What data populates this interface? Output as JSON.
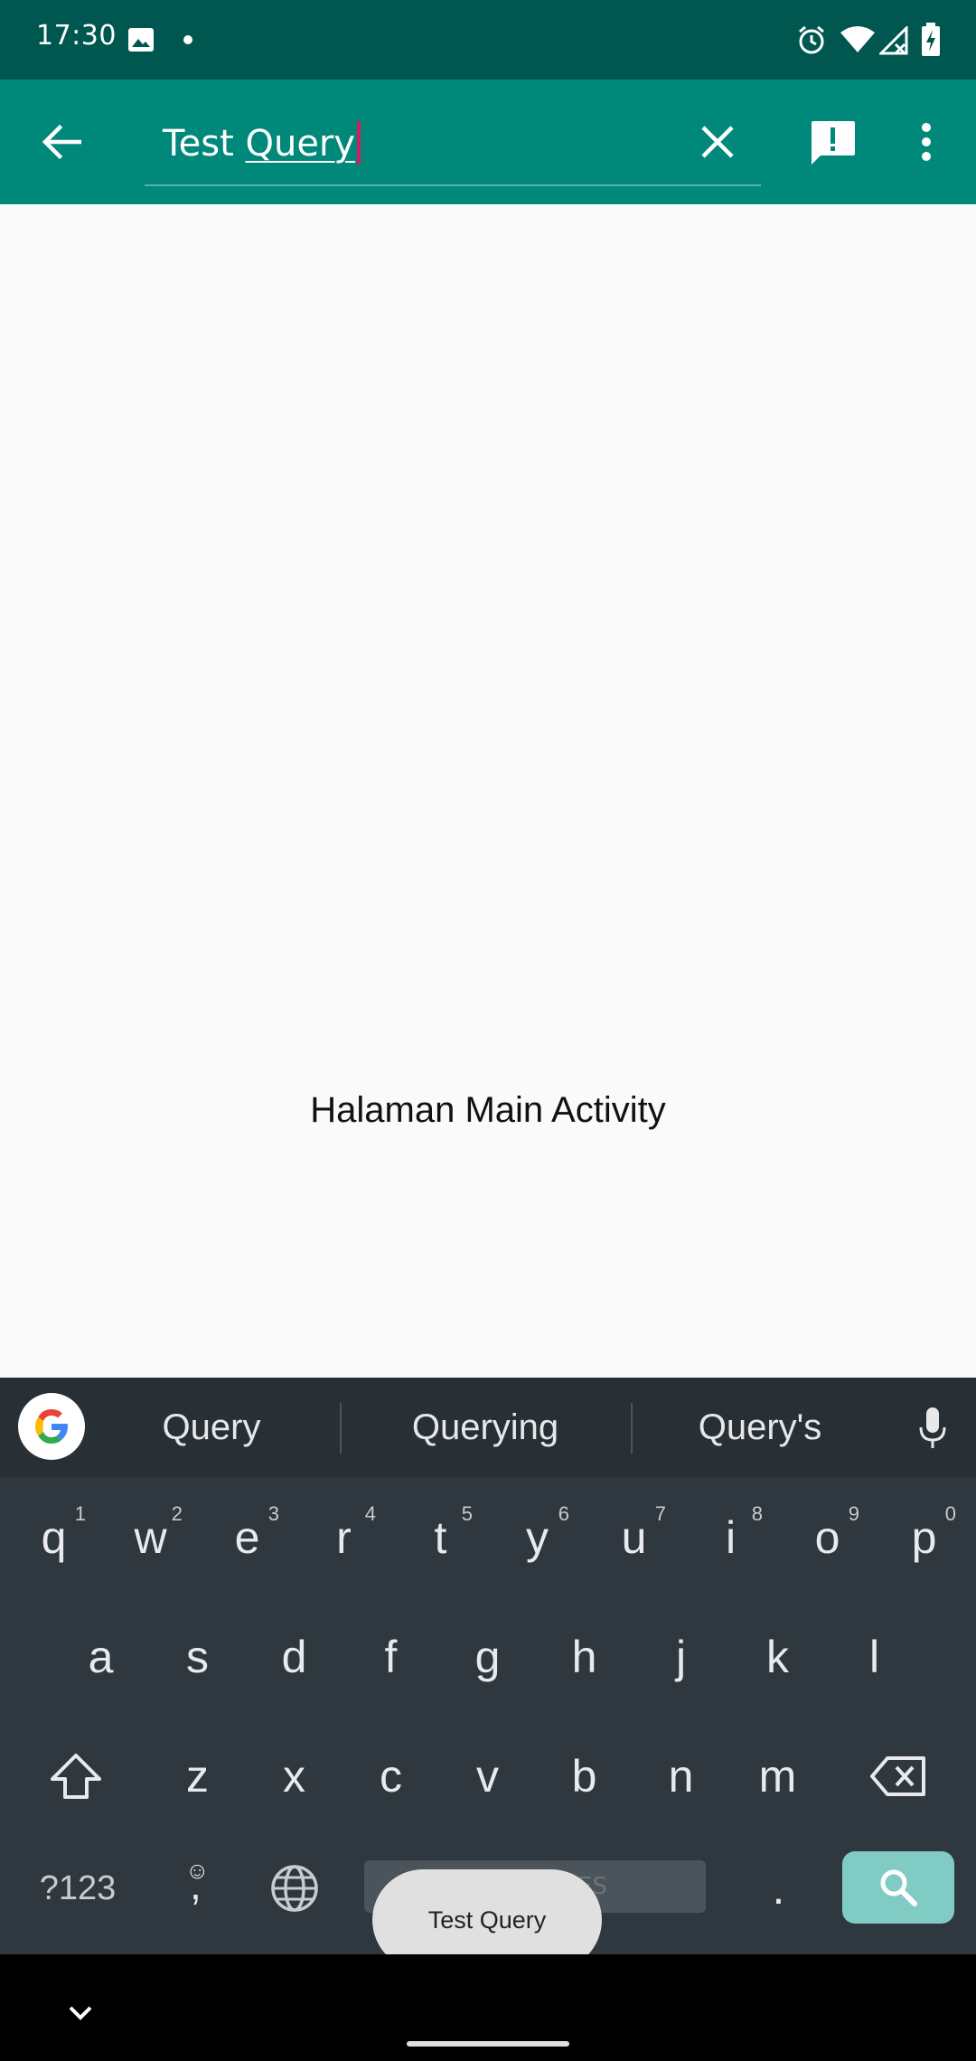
{
  "status_bar": {
    "time": "17:30",
    "icons": [
      "image-icon",
      "dot-icon",
      "alarm-icon",
      "wifi-icon",
      "signal-icon",
      "battery-charging-icon"
    ]
  },
  "app_bar": {
    "back_icon": "arrow-left-icon",
    "search": {
      "text_plain": "Test ",
      "text_composing": "Query"
    },
    "clear_icon": "close-icon",
    "feedback_icon": "report-icon",
    "overflow_icon": "more-vert-icon",
    "colors": {
      "primary": "#00897b",
      "primary_dark": "#00574f",
      "accent": "#d81b60"
    }
  },
  "content": {
    "label": "Halaman Main Activity"
  },
  "keyboard": {
    "suggestions": [
      "Query",
      "Querying",
      "Query's"
    ],
    "row1": [
      {
        "key": "q",
        "sup": "1"
      },
      {
        "key": "w",
        "sup": "2"
      },
      {
        "key": "e",
        "sup": "3"
      },
      {
        "key": "r",
        "sup": "4"
      },
      {
        "key": "t",
        "sup": "5"
      },
      {
        "key": "y",
        "sup": "6"
      },
      {
        "key": "u",
        "sup": "7"
      },
      {
        "key": "i",
        "sup": "8"
      },
      {
        "key": "o",
        "sup": "9"
      },
      {
        "key": "p",
        "sup": "0"
      }
    ],
    "row2": [
      "a",
      "s",
      "d",
      "f",
      "g",
      "h",
      "j",
      "k",
      "l"
    ],
    "row3": [
      "z",
      "x",
      "c",
      "v",
      "b",
      "n",
      "m"
    ],
    "symbols_key": "?123",
    "comma_key": ",",
    "period_key": ".",
    "space_label": "EN • IN • ES"
  },
  "toast": {
    "text": "Test Query"
  }
}
